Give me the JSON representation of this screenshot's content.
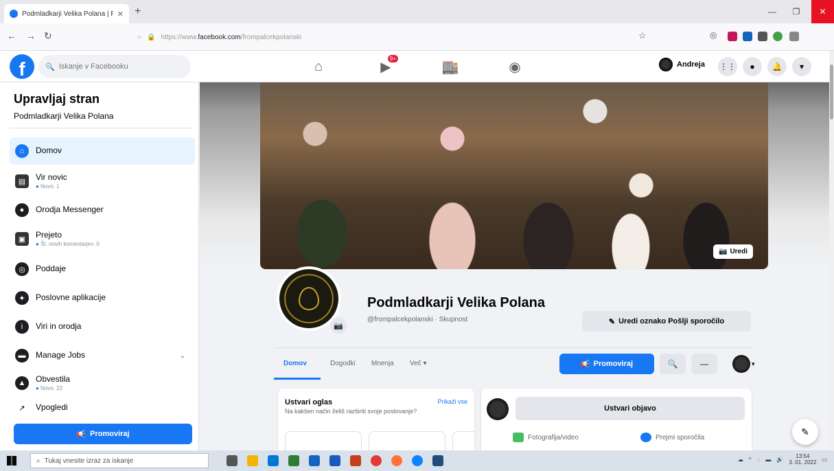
{
  "browser": {
    "tab_title": "Podmladkarji Velika Polana | Fa",
    "url_domain": "facebook.com",
    "url_full": "https://www.facebook.com/frompalcekpolanski",
    "url_prefix": "https://www.",
    "url_suffix": "/frompalcekpolanski"
  },
  "fb": {
    "search_placeholder": "Iskanje v Facebooku",
    "notifications_badge": "9+",
    "profile_name": "Andreja"
  },
  "sidebar": {
    "title": "Upravljaj stran",
    "subtitle": "Podmladkarji Velika Polana",
    "items": [
      {
        "label": "Domov",
        "note": ""
      },
      {
        "label": "Vir novic",
        "note": "Novo: 1"
      },
      {
        "label": "Orodja Messenger",
        "note": ""
      },
      {
        "label": "Prejeto",
        "note": "Št. novih komentarjev: 0"
      },
      {
        "label": "Poddaje",
        "note": ""
      },
      {
        "label": "Poslovne aplikacije",
        "note": ""
      },
      {
        "label": "Viri in orodja",
        "note": ""
      },
      {
        "label": "Manage Jobs",
        "note": ""
      },
      {
        "label": "Obvestila",
        "note": "Novo: 22"
      },
      {
        "label": "Vpogledi",
        "note": ""
      }
    ],
    "promote_label": "Promoviraj"
  },
  "page": {
    "cover_edit_label": "Uredi",
    "name": "Podmladkarji Velika Polana",
    "handle": "@frompalcekpolanski · Skupnost",
    "edit_button_label": "Uredi oznako Pošlji sporočilo",
    "tabs": [
      "Domov",
      "Dogodki",
      "Mnenja",
      "Več ▾"
    ],
    "promote_label": "Promoviraj"
  },
  "ad_card": {
    "title": "Ustvari oglas",
    "link": "Prikaži vse",
    "description": "Na kakšen način želiš razširiti svoje poslovanje?"
  },
  "post_card": {
    "create_label": "Ustvari objavo",
    "photo_video": "Fotografija/video",
    "get_messages": "Prejmi sporočila"
  },
  "taskbar": {
    "search_placeholder": "Tukaj vnesite izraz za iskanje",
    "time": "13:54",
    "date": "3. 01. 2022"
  },
  "colors": {
    "fb_blue": "#1877f2",
    "badge_red": "#e41e3f"
  }
}
